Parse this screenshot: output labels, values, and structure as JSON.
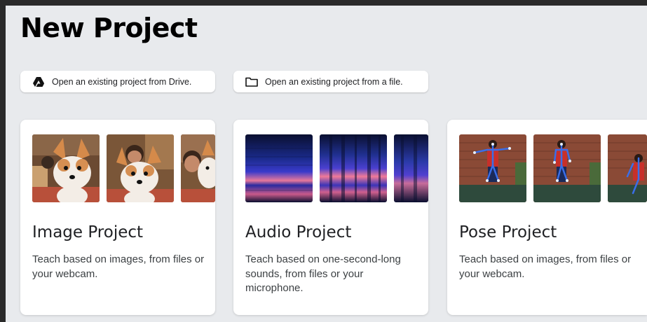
{
  "page": {
    "title": "New Project"
  },
  "actions": {
    "drive": {
      "label": "Open an existing project from Drive.",
      "icon": "google-drive-icon"
    },
    "file": {
      "label": "Open an existing project from a file.",
      "icon": "folder-icon"
    }
  },
  "cards": [
    {
      "title": "Image Project",
      "description": "Teach based on images, from files or your webcam.",
      "thumbnail": "corgi-plush-photo"
    },
    {
      "title": "Audio Project",
      "description": "Teach based on one-second-long sounds, from files or your microphone.",
      "thumbnail": "spectrogram"
    },
    {
      "title": "Pose Project",
      "description": "Teach based on images, from files or your webcam.",
      "thumbnail": "pose-skeleton-photo"
    }
  ],
  "colors": {
    "background": "#e8eaed",
    "card": "#ffffff",
    "text": "#202124",
    "spectrogram_dark": "#0b1440",
    "spectrogram_band": "#e86a8a",
    "pose_skeleton": "#3a6ee8"
  }
}
